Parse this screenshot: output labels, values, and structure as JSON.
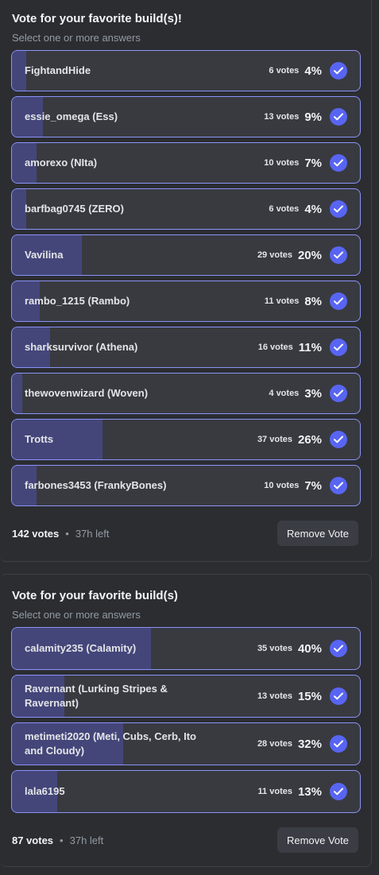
{
  "polls": [
    {
      "question": "Vote for your favorite build(s)!",
      "hint": "Select one or more answers",
      "answers": [
        {
          "label": "FightandHide",
          "votes": "6 votes",
          "percent": "4%",
          "fill": 0.04
        },
        {
          "label": "essie_omega (Ess)",
          "votes": "13 votes",
          "percent": "9%",
          "fill": 0.09
        },
        {
          "label": "amorexo (NIta)",
          "votes": "10 votes",
          "percent": "7%",
          "fill": 0.07
        },
        {
          "label": "barfbag0745 (ZERO)",
          "votes": "6 votes",
          "percent": "4%",
          "fill": 0.04
        },
        {
          "label": "Vavilina",
          "votes": "29 votes",
          "percent": "20%",
          "fill": 0.2
        },
        {
          "label": "rambo_1215 (Rambo)",
          "votes": "11 votes",
          "percent": "8%",
          "fill": 0.08
        },
        {
          "label": "sharksurvivor (Athena)",
          "votes": "16 votes",
          "percent": "11%",
          "fill": 0.11
        },
        {
          "label": "thewovenwizard (Woven)",
          "votes": "4 votes",
          "percent": "3%",
          "fill": 0.03
        },
        {
          "label": "Trotts",
          "votes": "37 votes",
          "percent": "26%",
          "fill": 0.26
        },
        {
          "label": "farbones3453 (FrankyBones)",
          "votes": "10 votes",
          "percent": "7%",
          "fill": 0.07
        }
      ],
      "total": "142 votes",
      "separator": "•",
      "time_left": "37h left",
      "remove_label": "Remove Vote"
    },
    {
      "question": "Vote for your favorite build(s)",
      "hint": "Select one or more answers",
      "answers": [
        {
          "label": "calamity235 (Calamity)",
          "votes": "35 votes",
          "percent": "40%",
          "fill": 0.4
        },
        {
          "label": "Ravernant (Lurking Stripes & Ravernant)",
          "votes": "13 votes",
          "percent": "15%",
          "fill": 0.15
        },
        {
          "label": "metimeti2020 (Meti, Cubs, Cerb, Ito and Cloudy)",
          "votes": "28 votes",
          "percent": "32%",
          "fill": 0.32
        },
        {
          "label": "lala6195",
          "votes": "11 votes",
          "percent": "13%",
          "fill": 0.13
        }
      ],
      "total": "87 votes",
      "separator": "•",
      "time_left": "37h left",
      "remove_label": "Remove Vote"
    }
  ],
  "icons": {
    "selected": "checkmark-icon"
  },
  "colors": {
    "accent": "#5865f2",
    "border": "#8b93f8",
    "fill": "#44467a",
    "bg": "#2b2d31"
  }
}
